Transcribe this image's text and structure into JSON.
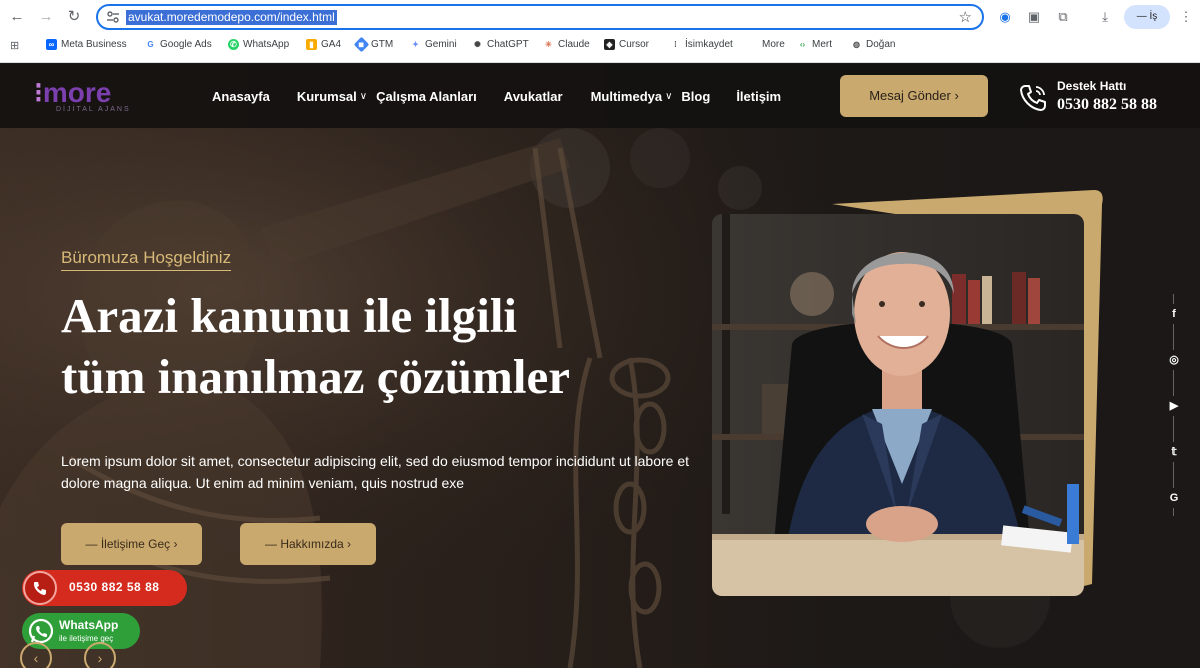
{
  "browser": {
    "url": "avukat.moredemodepo.com/index.html",
    "profile_label": "— İş",
    "bookmarks": [
      {
        "label": "Meta Business",
        "icon": "meta-icon",
        "color": "#0866ff"
      },
      {
        "label": "Google Ads",
        "icon": "google-icon",
        "color": "#4285f4"
      },
      {
        "label": "WhatsApp",
        "icon": "whatsapp-icon",
        "color": "#25d366"
      },
      {
        "label": "GA4",
        "icon": "analytics-icon",
        "color": "#f9ab00"
      },
      {
        "label": "GTM",
        "icon": "gtm-icon",
        "color": "#4285f4"
      },
      {
        "label": "Gemini",
        "icon": "gemini-icon",
        "color": "#6b8df5"
      },
      {
        "label": "ChatGPT",
        "icon": "chatgpt-icon",
        "color": "#444444"
      },
      {
        "label": "Claude",
        "icon": "claude-icon",
        "color": "#d97757"
      },
      {
        "label": "Cursor",
        "icon": "cursor-icon",
        "color": "#222222"
      },
      {
        "label": "İsimkaydet",
        "icon": "isimkaydet-icon",
        "color": "#555555"
      },
      {
        "label": "More",
        "icon": "folder-icon",
        "color": "#ffffff"
      },
      {
        "label": "Mert",
        "icon": "code-icon",
        "color": "#34a853"
      },
      {
        "label": "Doğan",
        "icon": "globe-icon",
        "color": "#555555"
      }
    ]
  },
  "site": {
    "logo_text": "more",
    "logo_sub": "DİJİTAL AJANS",
    "nav": [
      {
        "label": "Anasayfa",
        "has_dropdown": false
      },
      {
        "label": "Kurumsal",
        "has_dropdown": true
      },
      {
        "label": "Çalışma Alanları",
        "has_dropdown": false
      },
      {
        "label": "Avukatlar",
        "has_dropdown": false
      },
      {
        "label": "Multimedya",
        "has_dropdown": true
      },
      {
        "label": "Blog",
        "has_dropdown": false
      },
      {
        "label": "İletişim",
        "has_dropdown": false
      }
    ],
    "cta_label": "Mesaj Gönder",
    "support_label": "Destek Hattı",
    "support_phone": "0530 882 58 88",
    "hero": {
      "subtitle": "Büromuza Hoşgeldiniz",
      "title_line1": "Arazi kanunu ile ilgili",
      "title_line2": "tüm inanılmaz çözümler",
      "text": "Lorem ipsum dolor sit amet, consectetur adipiscing elit, sed do eiusmod tempor incididunt ut labore et dolore magna aliqua. Ut enim ad minim veniam, quis nostrud exe",
      "btn_contact": "İletişime Geç",
      "btn_about": "Hakkımızda"
    },
    "social": [
      "facebook-icon",
      "instagram-icon",
      "youtube-icon",
      "twitter-icon",
      "google-icon"
    ],
    "float_phone": "0530 882 58 88",
    "whatsapp_title": "WhatsApp",
    "whatsapp_sub": "ile iletişime geç",
    "accent_color": "#c9a96e"
  }
}
